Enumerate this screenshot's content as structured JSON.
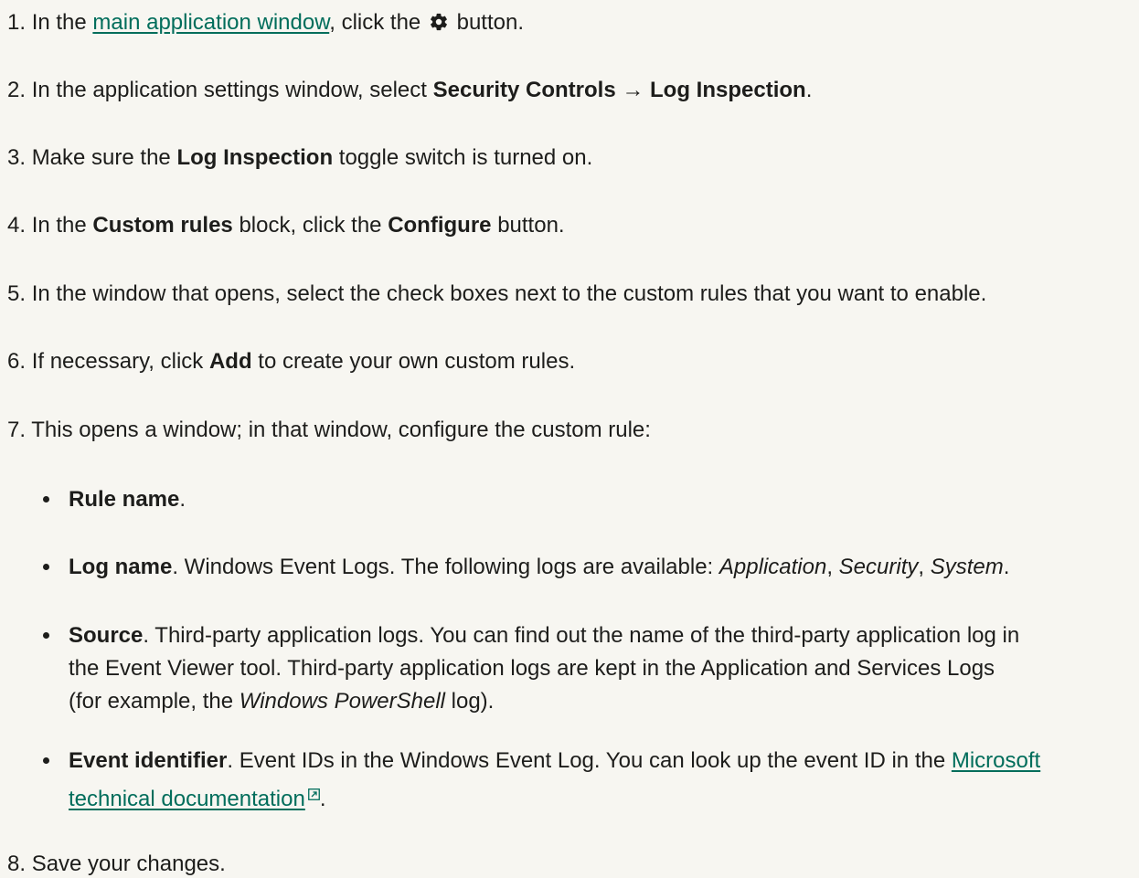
{
  "steps": [
    {
      "num": "1.",
      "pre": "In the",
      "link": "main application window",
      "mid": ", click the",
      "icon": "gear-icon",
      "post": "button."
    },
    {
      "num": "2.",
      "pre": "In the application settings window, select",
      "b1": "Security Controls",
      "arrow": "→",
      "b2": "Log Inspection",
      "post": "."
    },
    {
      "num": "3.",
      "pre": "Make sure the",
      "b1": "Log Inspection",
      "post": "toggle switch is turned on."
    },
    {
      "num": "4.",
      "pre": "In the",
      "b1": "Custom rules",
      "mid": "block, click the",
      "b2": "Configure",
      "post": "button."
    },
    {
      "num": "5.",
      "text": "In the window that opens, select the check boxes next to the custom rules that you want to enable."
    },
    {
      "num": "6.",
      "pre": "If necessary, click",
      "b1": "Add",
      "post": "to create your own custom rules."
    },
    {
      "num": "7.",
      "text": "This opens a window; in that window, configure the custom rule:"
    },
    {
      "num": "8.",
      "text": "Save your changes."
    }
  ],
  "bullets": {
    "rule_name": {
      "term": "Rule name",
      "post": "."
    },
    "log_name": {
      "term": "Log name",
      "text": ". Windows Event Logs. The following logs are available:",
      "i1": "Application",
      "sep1": ",",
      "i2": "Security",
      "sep2": ",",
      "i3": "System",
      "end": "."
    },
    "source": {
      "term": "Source",
      "line1": ". Third-party application logs. You can find out the name of the third-party application log in",
      "line2": "the Event Viewer tool. Third-party application logs are kept in the Application and Services Logs",
      "line3_pre": "(for example, the",
      "line3_i": "Windows PowerShell",
      "line3_post": "log)."
    },
    "event_id": {
      "term": "Event identifier",
      "text": ". Event IDs in the Windows Event Log. You can look up the event ID in the",
      "link1": "Microsoft",
      "link2": "technical documentation",
      "icon": "external-link-icon",
      "end": "."
    }
  },
  "colors": {
    "link": "#006d5b",
    "text": "#1d1d1b",
    "background": "#f7f6f1"
  }
}
